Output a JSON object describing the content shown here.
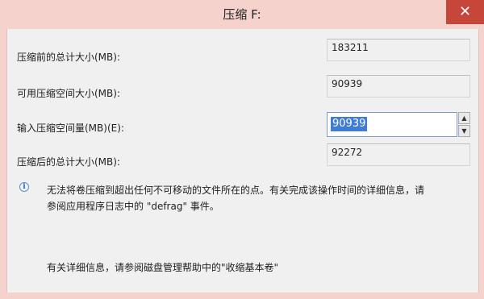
{
  "window": {
    "title": "压缩 F:",
    "close_glyph": "✕"
  },
  "fields": {
    "before_label": "压缩前的总计大小(MB):",
    "before_value": "183211",
    "available_label": "可用压缩空间大小(MB):",
    "available_value": "90939",
    "input_label": "输入压缩空间量(MB)(E):",
    "input_value": "90939",
    "after_label": "压缩后的总计大小(MB):",
    "after_value": "92272"
  },
  "spinner": {
    "up_glyph": "▲",
    "down_glyph": "▼"
  },
  "info": {
    "icon": "info-icon",
    "icon_glyph": "i",
    "line1": "无法将卷压缩到超出任何不可移动的文件所在的点。有关完成该操作时间的详细信息，请",
    "line2": "参阅应用程序日志中的 \"defrag\" 事件。"
  },
  "help": {
    "text": "有关详细信息，请参阅磁盘管理帮助中的\"收缩基本卷\""
  },
  "colors": {
    "titlebar": "#f5d2cc",
    "close": "#c7463a",
    "selection": "#3f7cd6"
  }
}
